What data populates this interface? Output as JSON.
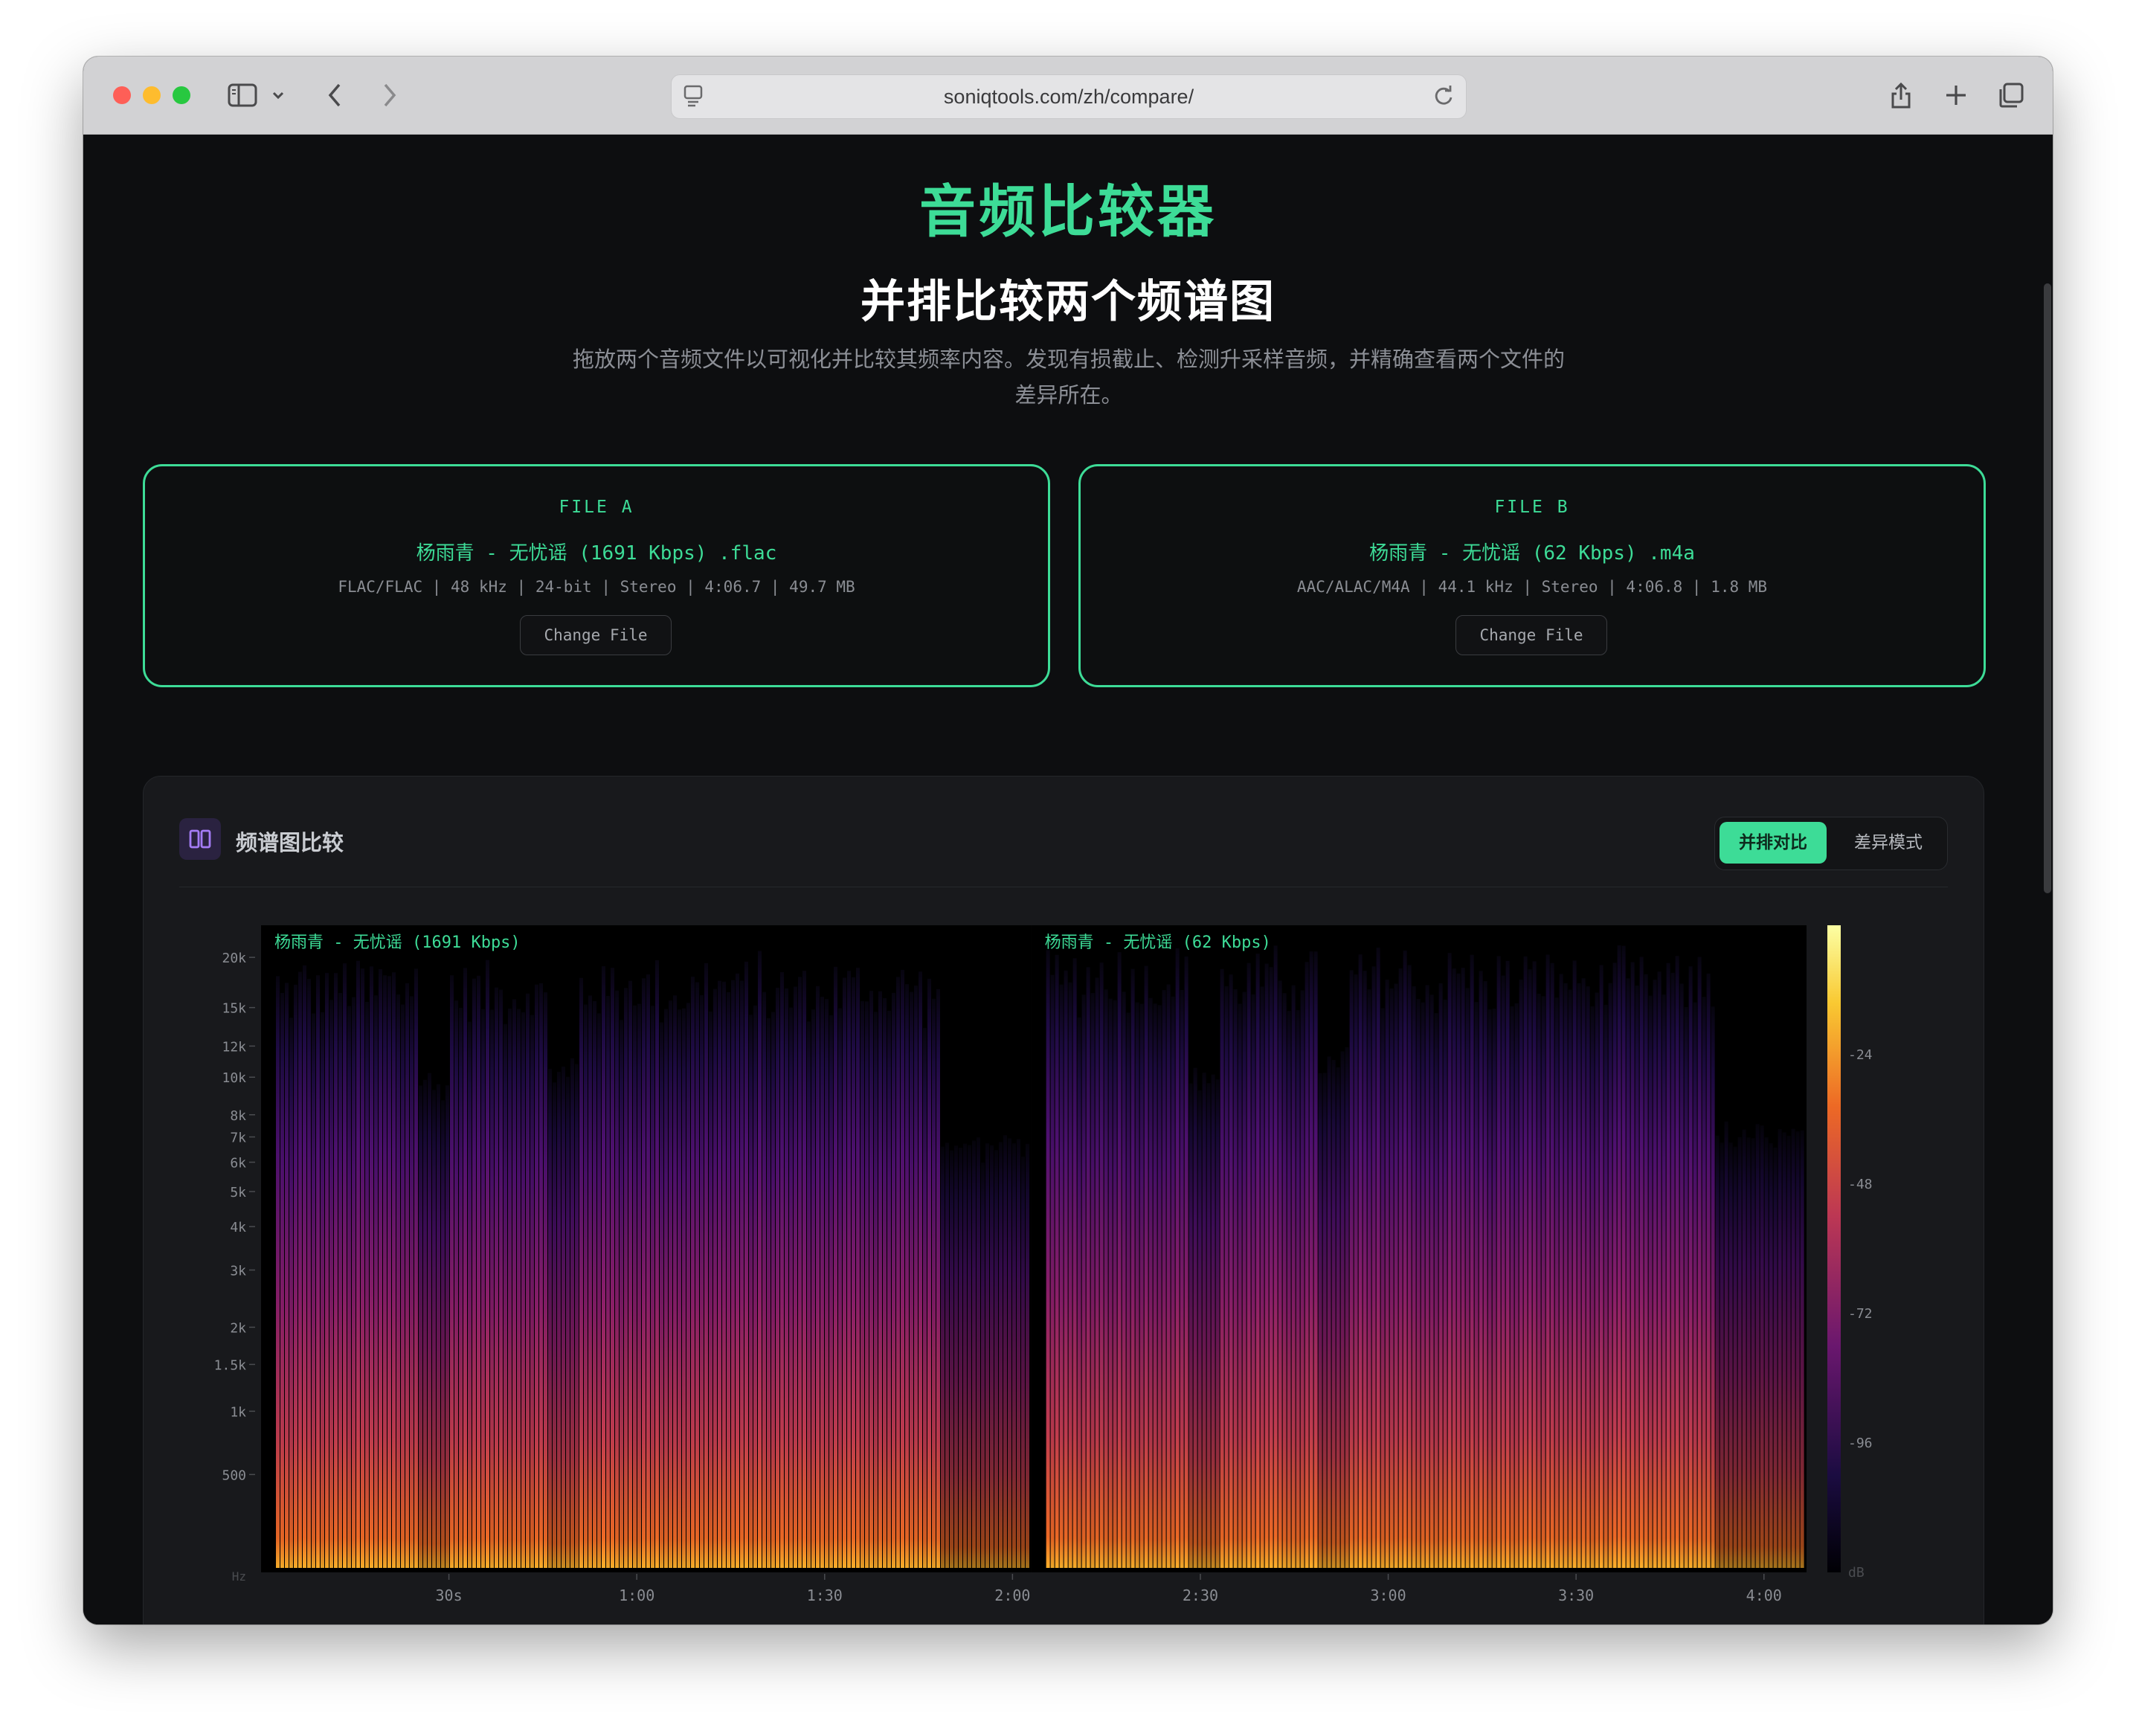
{
  "browser": {
    "url": "soniqtools.com/zh/compare/"
  },
  "page": {
    "title": "音频比较器",
    "subtitle": "并排比较两个频谱图",
    "description_line1": "拖放两个音频文件以可视化并比较其频率内容。发现有损截止、检测升采样音频，并精确查看两个文件的",
    "description_line2": "差异所在。"
  },
  "file_a": {
    "label": "FILE A",
    "name": "杨雨青 - 无忧谣 (1691 Kbps) .flac",
    "meta": "FLAC/FLAC | 48 kHz | 24-bit | Stereo | 4:06.7 | 49.7 MB",
    "change_label": "Change File"
  },
  "file_b": {
    "label": "FILE B",
    "name": "杨雨青 - 无忧谣 (62 Kbps) .m4a",
    "meta": "AAC/ALAC/M4A | 44.1 kHz | Stereo | 4:06.8 | 1.8 MB",
    "change_label": "Change File"
  },
  "panel": {
    "title": "频谱图比较",
    "toggle": {
      "side_by_side": "并排对比",
      "diff_mode": "差异模式"
    }
  },
  "colors": {
    "accent": "#3ddc97",
    "background": "#0d0e10",
    "panel": "#18191c"
  },
  "chart_data": {
    "type": "heatmap",
    "panes": [
      {
        "label": "杨雨青 - 无忧谣 (1691 Kbps)",
        "time_range_s": [
          0,
          123
        ],
        "cutoff_hz": 21000
      },
      {
        "label": "杨雨青 - 无忧谣 (62 Kbps)",
        "time_range_s": [
          123,
          246.8
        ],
        "cutoff_hz": 22000
      }
    ],
    "y_ticks": [
      "20k",
      "15k",
      "12k",
      "10k",
      "8k",
      "7k",
      "6k",
      "5k",
      "4k",
      "3k",
      "2k",
      "1.5k",
      "1k",
      "500",
      "Hz"
    ],
    "y_tick_values_hz": [
      20000,
      15000,
      12000,
      10000,
      8000,
      7000,
      6000,
      5000,
      4000,
      3000,
      2000,
      1500,
      1000,
      500,
      0
    ],
    "x_ticks": [
      "30s",
      "1:00",
      "1:30",
      "2:00",
      "2:30",
      "3:00",
      "3:30",
      "4:00"
    ],
    "x_tick_values_s": [
      30,
      60,
      90,
      120,
      150,
      180,
      210,
      240
    ],
    "colorbar_ticks": [
      "-24",
      "-48",
      "-72",
      "-96",
      "dB"
    ],
    "colorbar_values_db": [
      -24,
      -48,
      -72,
      -96,
      -120
    ],
    "colormap": "inferno",
    "y_scale": "mel"
  }
}
